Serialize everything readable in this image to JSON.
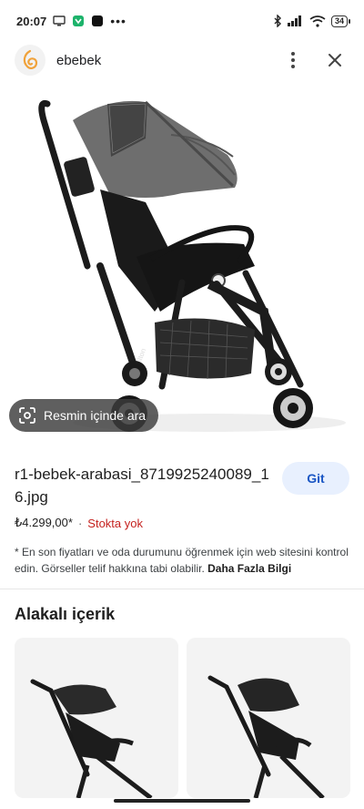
{
  "status_bar": {
    "time": "20:07",
    "battery": "34"
  },
  "header": {
    "site_name": "ebebek"
  },
  "image": {
    "lens_label": "Resmin içinde ara"
  },
  "result": {
    "title": "r1-bebek-arabasi_8719925240089_16.jpg",
    "go_button": "Git",
    "price": "₺4.299,00*",
    "separator": "·",
    "stock": "Stokta yok",
    "note": "* En son fiyatları ve oda durumunu öğrenmek için web sitesini kontrol edin. Görseller telif hakkına tabi olabilir.",
    "note_link": "Daha Fazla Bilgi"
  },
  "related": {
    "title": "Alakalı içerik"
  },
  "colors": {
    "accent": "#1a56c4",
    "button_bg": "#e8f0fe",
    "stock_red": "#c5221f",
    "logo_orange": "#f0a23a"
  }
}
